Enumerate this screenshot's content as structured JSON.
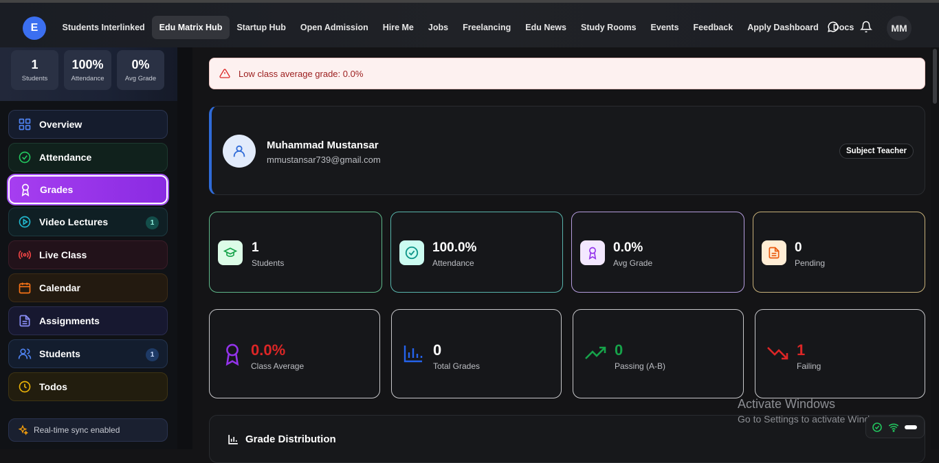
{
  "header": {
    "logo_text": "E",
    "nav": [
      "Students Interlinked",
      "Edu Matrix Hub",
      "Startup Hub",
      "Open Admission",
      "Hire Me",
      "Jobs",
      "Freelancing",
      "Edu News",
      "Study Rooms",
      "Events",
      "Feedback",
      "Apply Dashboard",
      "Docs"
    ],
    "active_nav": "Edu Matrix Hub",
    "avatar_initials": "MM"
  },
  "sidebar": {
    "stats": [
      {
        "value": "1",
        "label": "Students"
      },
      {
        "value": "100%",
        "label": "Attendance"
      },
      {
        "value": "0%",
        "label": "Avg Grade"
      }
    ],
    "items": [
      {
        "label": "Overview",
        "icon": "grid-icon",
        "color": "#4f83f1"
      },
      {
        "label": "Attendance",
        "icon": "check-circle-icon",
        "color": "#22c55e"
      },
      {
        "label": "Grades",
        "icon": "award-icon",
        "color": "#ffffff"
      },
      {
        "label": "Video Lectures",
        "icon": "play-circle-icon",
        "color": "#22b8cf",
        "badge": "1"
      },
      {
        "label": "Live Class",
        "icon": "broadcast-icon",
        "color": "#ef4444"
      },
      {
        "label": "Calendar",
        "icon": "calendar-icon",
        "color": "#f97316"
      },
      {
        "label": "Assignments",
        "icon": "document-icon",
        "color": "#8b8ff8"
      },
      {
        "label": "Students",
        "icon": "users-icon",
        "color": "#4f83f1",
        "badge": "1"
      },
      {
        "label": "Todos",
        "icon": "clock-icon",
        "color": "#eab308"
      }
    ],
    "sync_label": "Real-time sync enabled"
  },
  "alert": {
    "text": "Low class average grade: 0.0%"
  },
  "profile": {
    "name": "Muhammad Mustansar",
    "email": "mmustansar739@gmail.com",
    "role": "Subject Teacher"
  },
  "stats_row1": [
    {
      "value": "1",
      "label": "Students",
      "icon": "graduation-cap-icon",
      "accent": "#22c55e"
    },
    {
      "value": "100.0%",
      "label": "Attendance",
      "icon": "check-circle-icon",
      "accent": "#14b8a6"
    },
    {
      "value": "0.0%",
      "label": "Avg Grade",
      "icon": "award-icon",
      "accent": "#a855f7"
    },
    {
      "value": "0",
      "label": "Pending",
      "icon": "document-icon",
      "accent": "#f97316"
    }
  ],
  "stats_row2": [
    {
      "value": "0.0%",
      "label": "Class Average",
      "icon": "award-icon",
      "accent": "#dc2626"
    },
    {
      "value": "0",
      "label": "Total Grades",
      "icon": "bar-chart-icon",
      "accent": "#ffffff"
    },
    {
      "value": "0",
      "label": "Passing (A-B)",
      "icon": "trend-up-icon",
      "accent": "#16a34a"
    },
    {
      "value": "1",
      "label": "Failing",
      "icon": "trend-down-icon",
      "accent": "#dc2626"
    }
  ],
  "grade_distribution": {
    "title": "Grade Distribution"
  },
  "watermark": {
    "line1": "Activate Windows",
    "line2": "Go to Settings to activate Windows."
  }
}
